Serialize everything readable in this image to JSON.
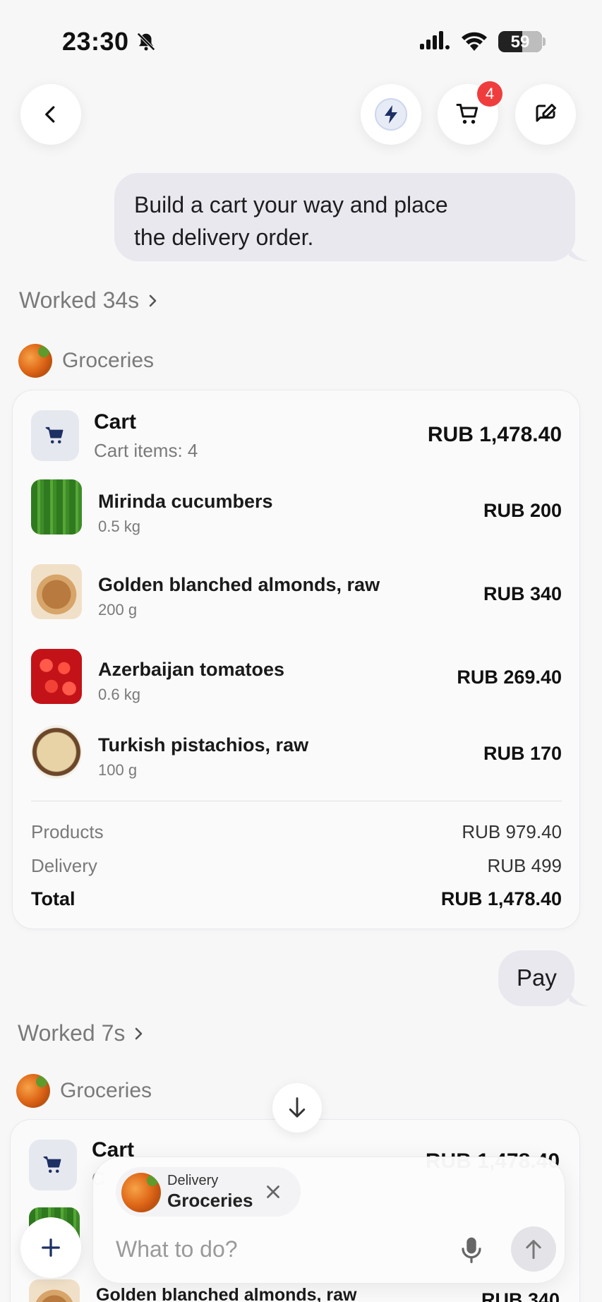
{
  "status": {
    "time": "23:30",
    "battery": "59"
  },
  "nav": {
    "cart_count": "4"
  },
  "chat": {
    "user_message_1": [
      "Build a cart your way and place",
      "the delivery order."
    ],
    "worked_1": "Worked 34s",
    "source_1": "Groceries",
    "cart": {
      "title": "Cart",
      "subtitle": "Cart items: 4",
      "total": "RUB 1,478.40",
      "items": [
        {
          "name": "Mirinda cucumbers",
          "qty": "0.5 kg",
          "price": "RUB 200",
          "image": "cucumbers"
        },
        {
          "name": "Golden blanched almonds, raw",
          "qty": "200 g",
          "price": "RUB 340",
          "image": "almonds"
        },
        {
          "name": "Azerbaijan tomatoes",
          "qty": "0.6 kg",
          "price": "RUB 269.40",
          "image": "tomatoes"
        },
        {
          "name": "Turkish pistachios, raw",
          "qty": "100 g",
          "price": "RUB 170",
          "image": "pistachios"
        }
      ],
      "summary": {
        "products_label": "Products",
        "products_value": "RUB 979.40",
        "delivery_label": "Delivery",
        "delivery_value": "RUB 499",
        "total_label": "Total",
        "total_value": "RUB 1,478.40"
      }
    },
    "user_message_2": "Pay",
    "worked_2": "Worked 7s",
    "source_2": "Groceries",
    "cart2": {
      "title": "Cart",
      "subtitle_partial": "C",
      "total_partial": "RUB 1,478.40",
      "item_partial_name": "Golden blanched almonds, raw",
      "item_partial_price": "RUB 340"
    }
  },
  "composer": {
    "chip_small": "Delivery",
    "chip_big": "Groceries",
    "placeholder": "What to do?"
  }
}
